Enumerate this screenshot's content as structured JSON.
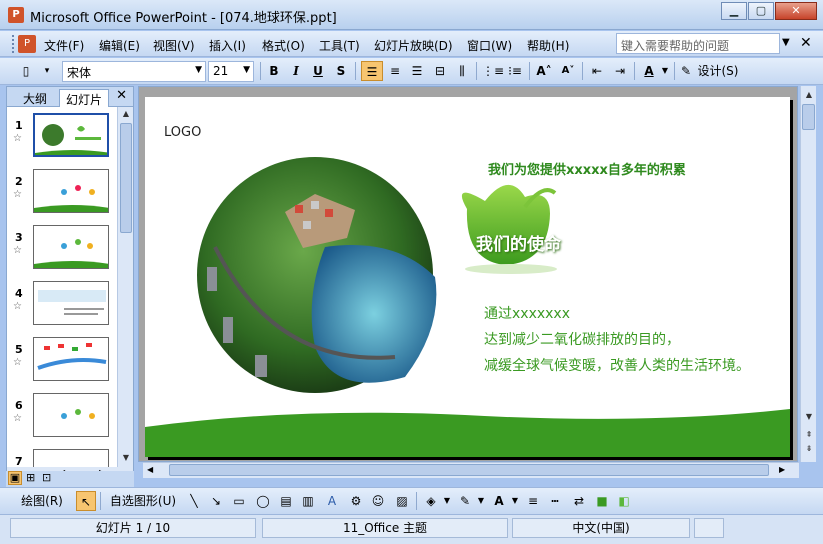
{
  "window": {
    "title": "Microsoft Office PowerPoint - [074.地球环保.ppt]",
    "app_icon": "P"
  },
  "menus": [
    "文件(F)",
    "编辑(E)",
    "视图(V)",
    "插入(I)",
    "格式(O)",
    "工具(T)",
    "幻灯片放映(D)",
    "窗口(W)",
    "帮助(H)"
  ],
  "help_search": {
    "placeholder": "键入需要帮助的问题"
  },
  "formatting": {
    "font": "宋体",
    "size": "21",
    "bold": "B",
    "italic": "I",
    "underline": "U",
    "shadow": "S",
    "design": "设计(S)"
  },
  "left_pane": {
    "tabs": [
      "大纲",
      "幻灯片"
    ],
    "active_tab": "幻灯片",
    "slide_numbers": [
      "1",
      "2",
      "3",
      "4",
      "5",
      "6",
      "7"
    ],
    "selected_slide": "1"
  },
  "slide": {
    "logo": "LOGO",
    "headline": "我们为您提供xxxxx自多年的积累",
    "mission": "我们的使命",
    "body_lines": [
      "通过xxxxxxx",
      "达到减少二氧化碳排放的目的，",
      "减缓全球气候变暖，改善人类的生活环境。"
    ]
  },
  "drawing_toolbar": {
    "draw": "绘图(R)",
    "autoshapes": "自选图形(U)"
  },
  "statusbar": {
    "slide": "幻灯片 1 / 10",
    "theme": "11_Office 主题",
    "language": "中文(中国)"
  },
  "colors": {
    "accent_green": "#3a9a22",
    "toolbar_blue": "#c5d8f2"
  }
}
